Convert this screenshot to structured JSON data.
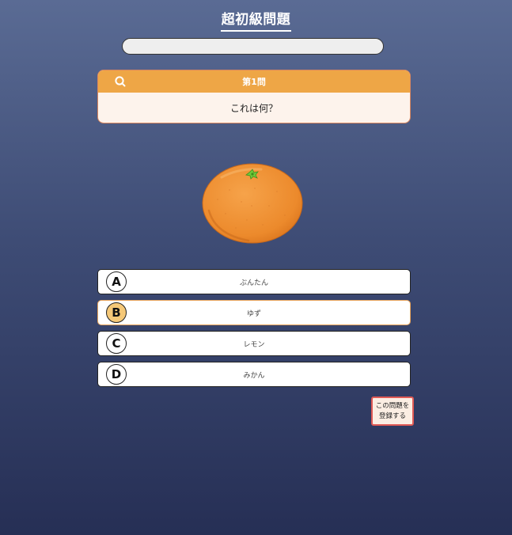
{
  "header": {
    "title": "超初級問題"
  },
  "progress": {
    "fraction": 0.0
  },
  "question": {
    "number_label": "第1問",
    "text": "これは何？",
    "icon": "search-icon",
    "image": "mandarin-orange-image"
  },
  "choices": [
    {
      "letter": "A",
      "text": "ぶんたん",
      "selected": false
    },
    {
      "letter": "B",
      "text": "ゆず",
      "selected": true
    },
    {
      "letter": "C",
      "text": "レモン",
      "selected": false
    },
    {
      "letter": "D",
      "text": "みかん",
      "selected": false
    }
  ],
  "register_button": {
    "line1": "この問題を",
    "line2": "登録する"
  },
  "colors": {
    "accent": "#eea646",
    "selected_choice": "#f5c878",
    "register_border": "#e05a55",
    "background_top": "#5a6b94",
    "background_bottom": "#262f55"
  }
}
